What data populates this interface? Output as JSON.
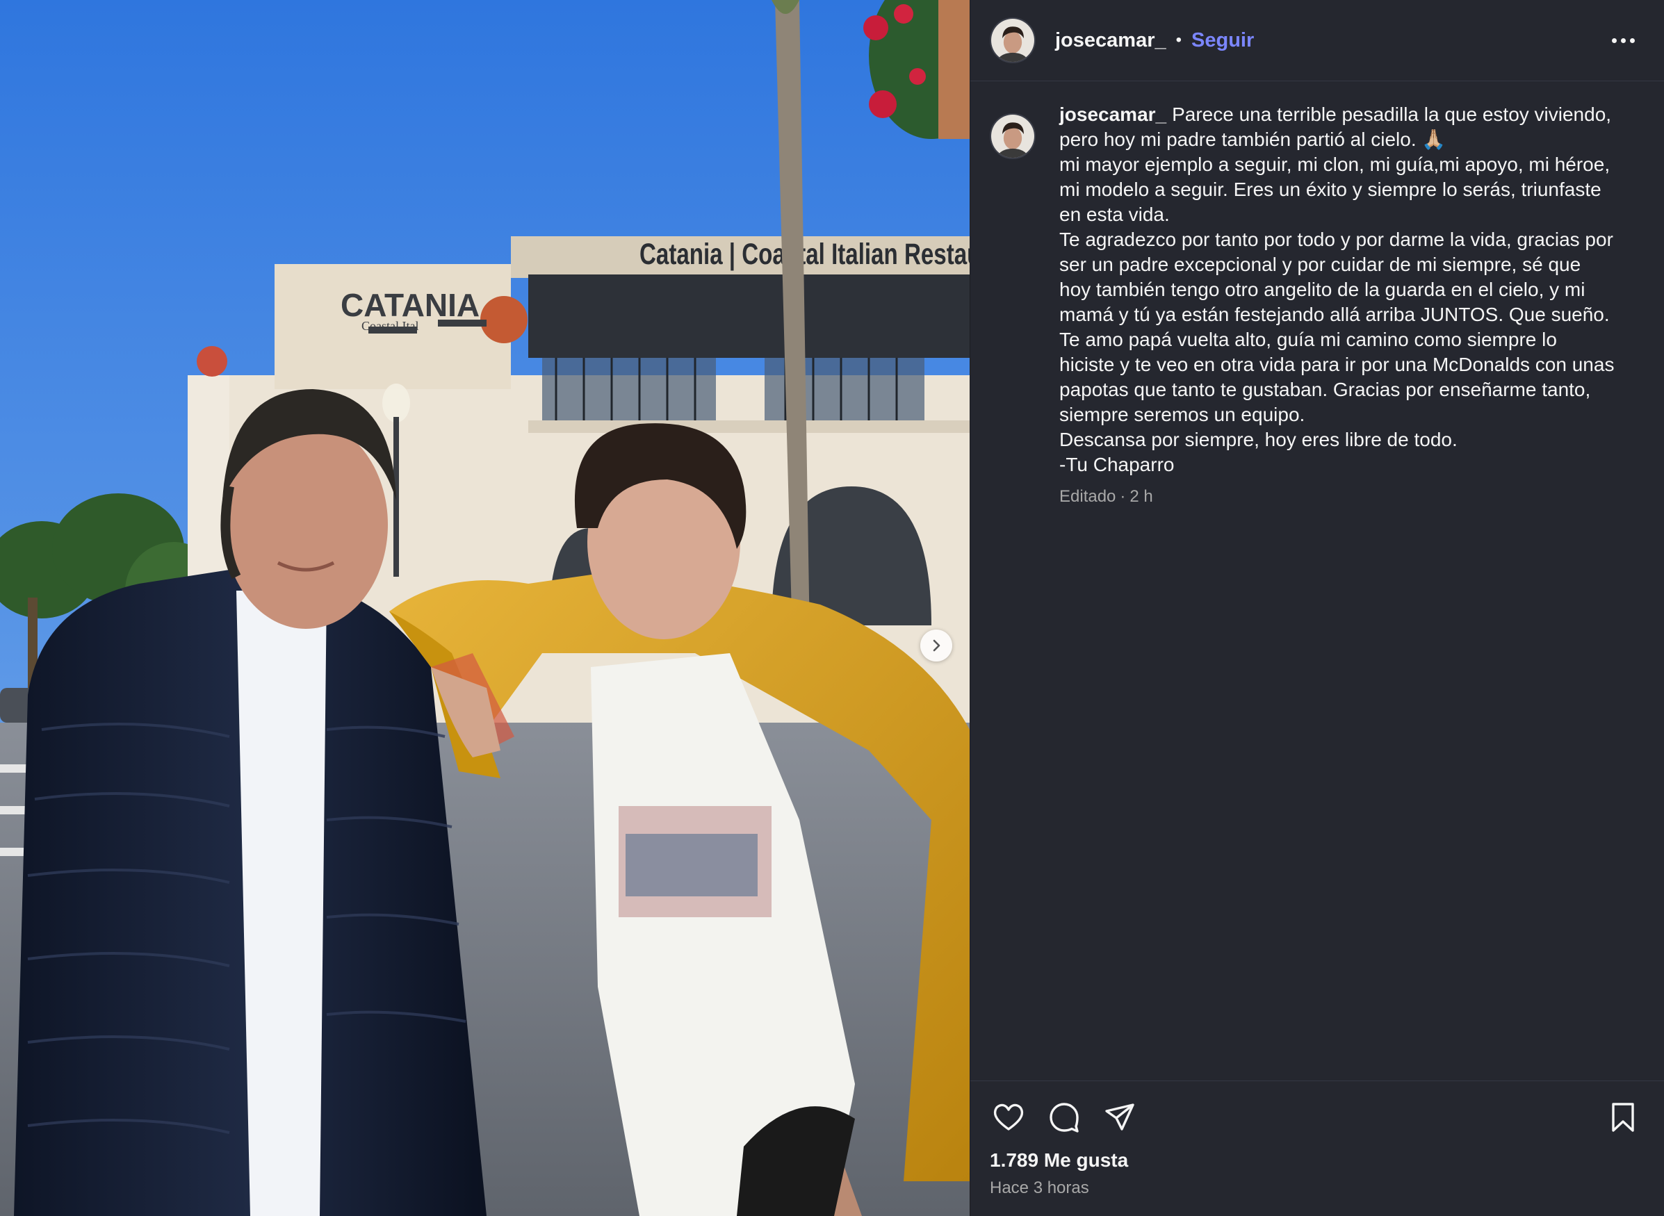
{
  "post": {
    "username": "josecamar_",
    "follow_label": "Seguir",
    "header_separator": "•",
    "caption_text": "Parece una terrible pesadilla la que estoy viviendo, pero hoy mi padre también partió al cielo. 🙏🏼\nmi mayor ejemplo a seguir, mi clon, mi guía,mi apoyo, mi héroe, mi modelo a seguir. Eres un éxito y siempre lo serás, triunfaste en esta vida.\nTe agradezco por tanto por todo y por darme la vida, gracias por ser un padre excepcional y por cuidar de mi siempre, sé que hoy también tengo otro angelito de la guarda en el cielo, y mi mamá y tú ya están festejando allá arriba JUNTOS. Que sueño.\nTe amo papá vuelta alto, guía mi camino como siempre lo hiciste y te veo en otra vida para ir por una McDonalds con unas papotas que tanto te gustaban. Gracias por enseñarme tanto, siempre seremos un equipo.\nDescansa por siempre, hoy eres libre de todo.\n-Tu Chaparro",
    "edited_label": "Editado",
    "meta_separator": "·",
    "comment_age": "2 h",
    "likes": "1.789 Me gusta",
    "time_ago": "Hace 3 horas"
  },
  "media": {
    "sign_top": "Catania | Coastal Italian Restaura",
    "sign_logo": "CATANIA",
    "sign_logo_sub": "Coastal Ital"
  },
  "icons": {
    "more": "more-options-icon",
    "like": "heart-icon",
    "comment": "comment-icon",
    "share": "paper-plane-icon",
    "save": "bookmark-icon",
    "next": "chevron-right-icon"
  },
  "colors": {
    "panel_bg": "#25272f",
    "follow_blue": "#7b86ff",
    "sky": "#3b7fd8",
    "jacket_yellow": "#d9a21f",
    "puffer_navy": "#141c2e"
  }
}
